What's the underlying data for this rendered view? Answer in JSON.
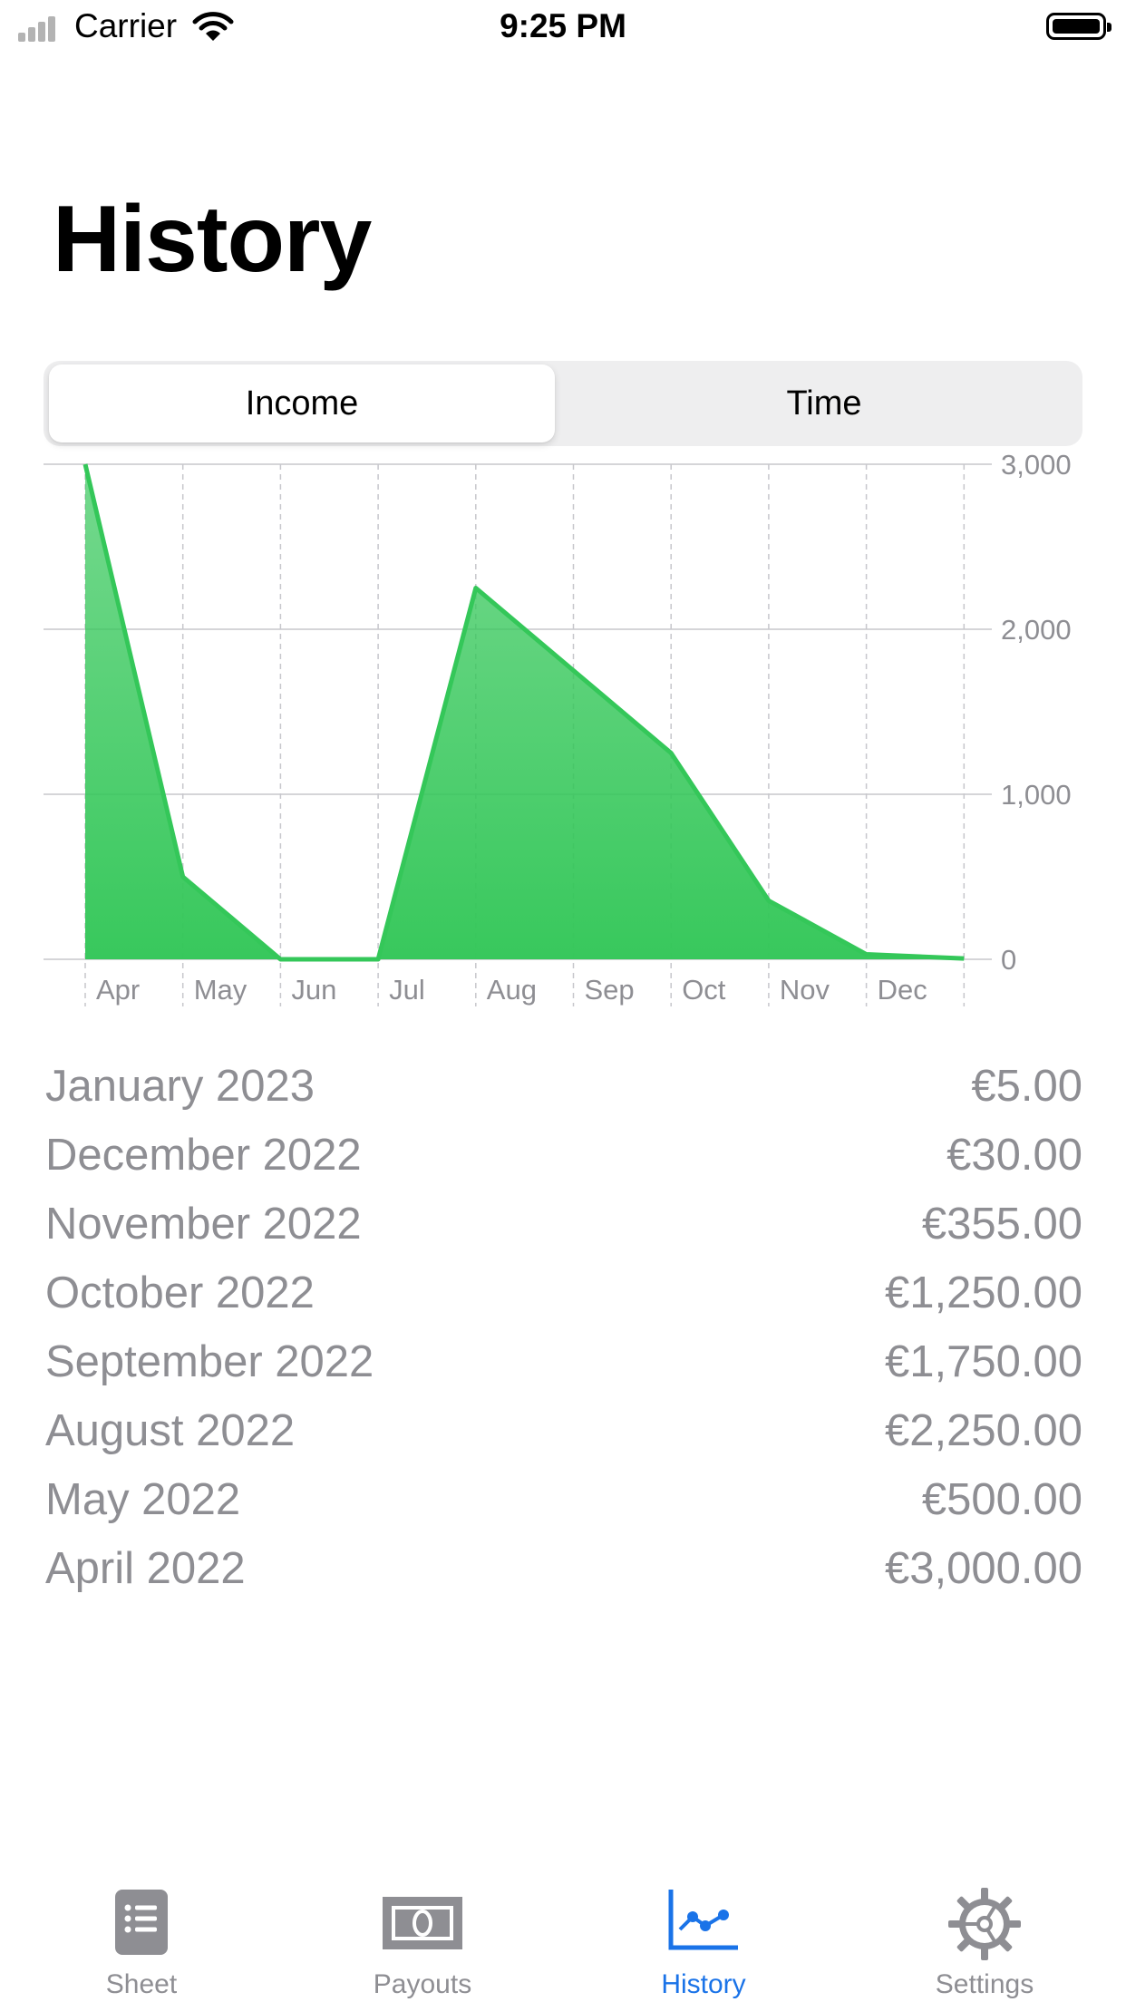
{
  "status_bar": {
    "carrier": "Carrier",
    "time": "9:25 PM"
  },
  "page": {
    "title": "History"
  },
  "segmented": {
    "options": [
      "Income",
      "Time"
    ],
    "selected": "Income"
  },
  "chart_data": {
    "type": "area",
    "categories": [
      "Apr",
      "May",
      "Jun",
      "Jul",
      "Aug",
      "Sep",
      "Oct",
      "Nov",
      "Dec",
      "Jan"
    ],
    "values": [
      3000,
      500,
      0,
      0,
      2250,
      1750,
      1250,
      355,
      30,
      5
    ],
    "x_tick_labels": [
      "Apr",
      "May",
      "Jun",
      "Jul",
      "Aug",
      "Sep",
      "Oct",
      "Nov",
      "Dec"
    ],
    "y_ticks": [
      0,
      1000,
      2000,
      3000
    ],
    "y_tick_labels": [
      "0",
      "1,000",
      "2,000",
      "3,000"
    ],
    "ylim": [
      0,
      3000
    ],
    "color": "#34c759",
    "grid": true
  },
  "history_list": [
    {
      "month": "January 2023",
      "amount": "€5.00"
    },
    {
      "month": "December 2022",
      "amount": "€30.00"
    },
    {
      "month": "November 2022",
      "amount": "€355.00"
    },
    {
      "month": "October 2022",
      "amount": "€1,250.00"
    },
    {
      "month": "September 2022",
      "amount": "€1,750.00"
    },
    {
      "month": "August 2022",
      "amount": "€2,250.00"
    },
    {
      "month": "May 2022",
      "amount": "€500.00"
    },
    {
      "month": "April 2022",
      "amount": "€3,000.00"
    }
  ],
  "tab_bar": {
    "items": [
      {
        "label": "Sheet",
        "icon": "list-sheet-icon"
      },
      {
        "label": "Payouts",
        "icon": "banknote-icon"
      },
      {
        "label": "History",
        "icon": "line-chart-icon"
      },
      {
        "label": "Settings",
        "icon": "gear-icon"
      }
    ],
    "selected": "History",
    "active_color": "#1a73e8",
    "inactive_color": "#8e8e93"
  }
}
